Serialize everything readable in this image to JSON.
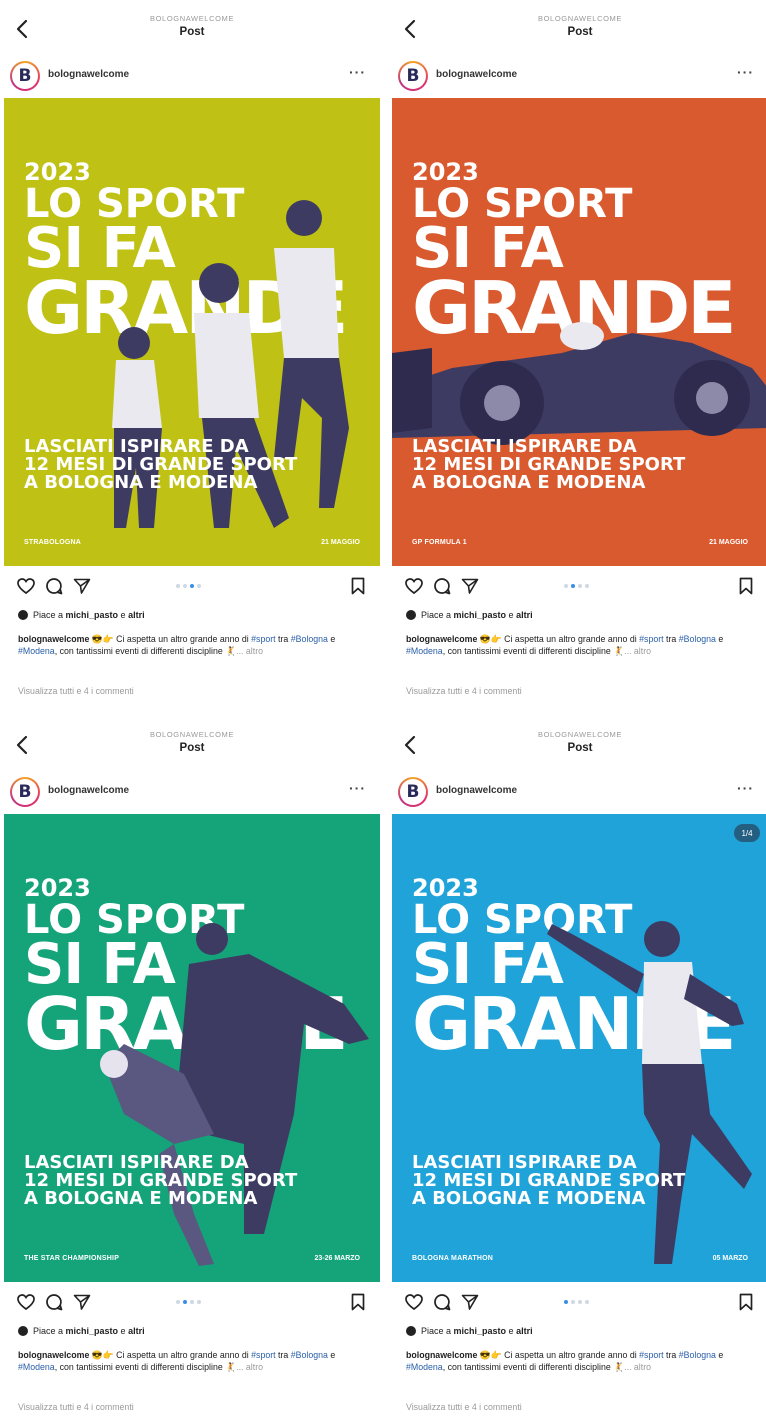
{
  "common": {
    "account_small": "BOLOGNAWELCOME",
    "page_title": "Post",
    "username": "bolognawelcome",
    "more_label": "···",
    "avatar_letter": "B",
    "headline": {
      "year": "2023",
      "line1": "LO SPORT",
      "line2": "SI FA",
      "line3": "GRANDE"
    },
    "tagline": [
      "LASCIATI ISPIRARE DA",
      "12 MESI DI GRANDE SPORT",
      "A BOLOGNA E MODENA"
    ],
    "likes": {
      "prefix": "Piace a ",
      "user": "michi_pasto",
      "mid": " e ",
      "others": "altri"
    },
    "caption": {
      "username": "bolognawelcome",
      "emoji": " 😎👉 ",
      "text1": "Ci aspetta un altro grande anno di ",
      "tag_sport": "#sport",
      "text2": " tra ",
      "tag_bologna": "#Bologna",
      "text3": " e ",
      "tag_modena": "#Modena",
      "text4": ", con tantissimi eventi di differenti discipline 🤾",
      "more": "... altro"
    },
    "comments_link": "Visualizza tutti e 4 i commenti",
    "colors": {
      "green_lime": "#bfc215",
      "orange": "#d95a2e",
      "teal": "#15a37a",
      "blue": "#1fa3d8",
      "figure": "#3e3b63"
    },
    "icons": [
      "back-icon",
      "heart-icon",
      "comment-icon",
      "share-icon",
      "bookmark-icon",
      "more-icon"
    ]
  },
  "posts": [
    {
      "event_name": "STRABOLOGNA",
      "event_date": "21 MAGGIO",
      "bg": "#bfc215",
      "carousel_index": 3,
      "carousel_count": 4
    },
    {
      "event_name": "GP FORMULA 1",
      "event_date": "21 MAGGIO",
      "bg": "#d95a2e",
      "carousel_index": 2,
      "carousel_count": 4
    },
    {
      "event_name": "THE STAR CHAMPIONSHIP",
      "event_date": "23-26 MARZO",
      "bg": "#15a37a",
      "carousel_index": 2,
      "carousel_count": 4
    },
    {
      "event_name": "BOLOGNA MARATHON",
      "event_date": "05 MARZO",
      "bg": "#1fa3d8",
      "carousel_index": 1,
      "carousel_count": 4,
      "badge": "1/4"
    }
  ]
}
